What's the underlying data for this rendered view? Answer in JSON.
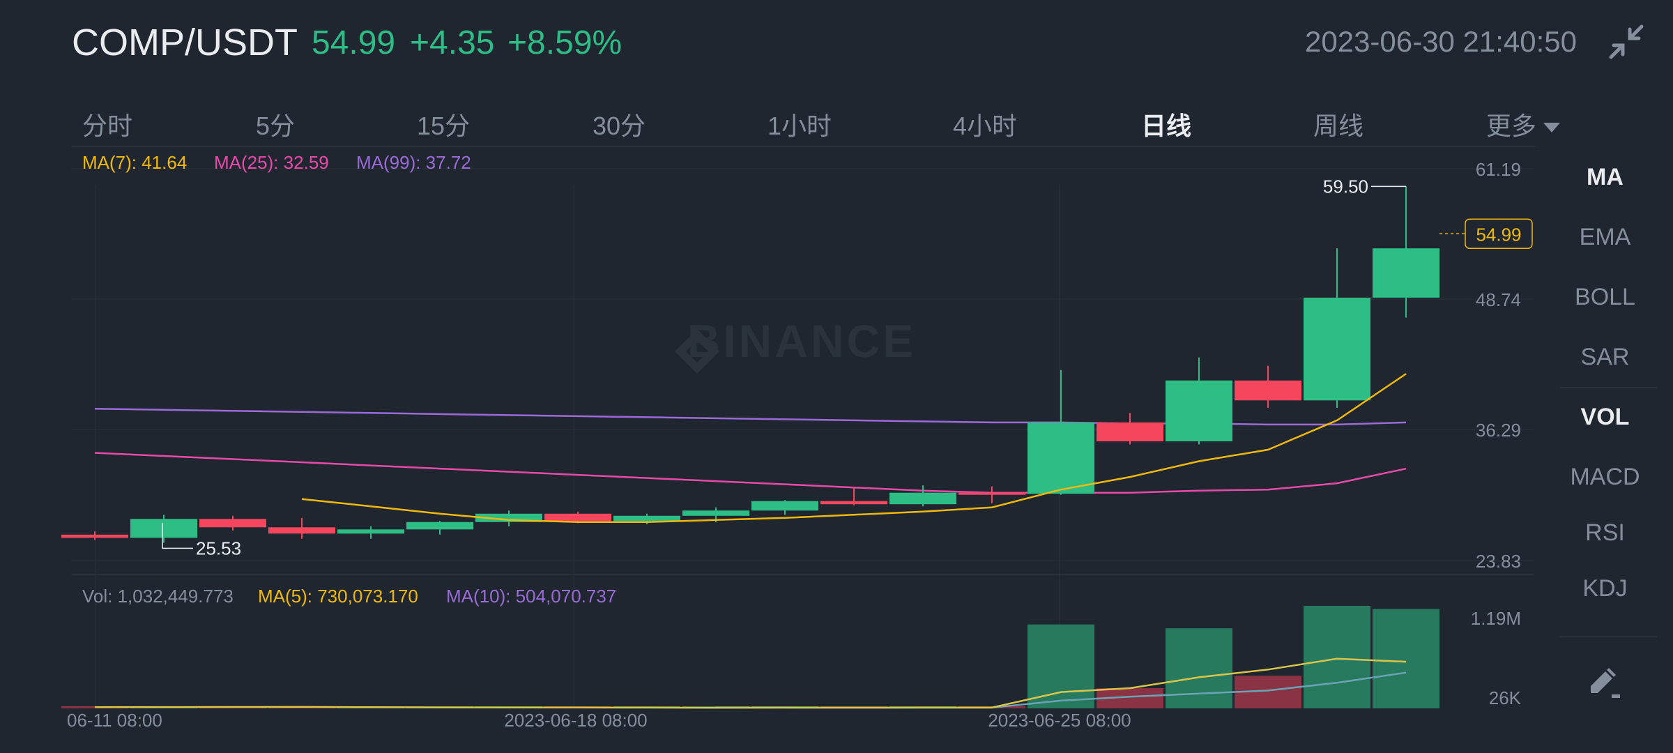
{
  "header": {
    "pair": "COMP/USDT",
    "price": "54.99",
    "change": "+4.35",
    "change_pct": "+8.59%",
    "datetime": "2023-06-30 21:40:50",
    "icon": "collapse-arrows-icon"
  },
  "tabs": [
    {
      "label": "分时",
      "active": false
    },
    {
      "label": "5分",
      "active": false
    },
    {
      "label": "15分",
      "active": false
    },
    {
      "label": "30分",
      "active": false
    },
    {
      "label": "1小时",
      "active": false
    },
    {
      "label": "4小时",
      "active": false
    },
    {
      "label": "日线",
      "active": true
    },
    {
      "label": "周线",
      "active": false
    },
    {
      "label": "更多",
      "active": false
    }
  ],
  "side_indicators": [
    {
      "label": "MA",
      "active": true
    },
    {
      "label": "EMA",
      "active": false
    },
    {
      "label": "BOLL",
      "active": false
    },
    {
      "label": "SAR",
      "active": false
    },
    {
      "label": "VOL",
      "active": true
    },
    {
      "label": "MACD",
      "active": false
    },
    {
      "label": "RSI",
      "active": false
    },
    {
      "label": "KDJ",
      "active": false
    }
  ],
  "colors": {
    "up": "#2ebd85",
    "down": "#f6465d",
    "ma7": "#f0b90b",
    "ma25": "#e84aa9",
    "ma99": "#9a6bd6",
    "vol_ma5": "#d9c54a",
    "vol_ma10": "#6aa3b5",
    "bg": "#1f2630",
    "grid": "#2b3139",
    "text": "#848e9c"
  },
  "legend": {
    "ma7": "MA(7): 41.64",
    "ma25": "MA(25): 32.59",
    "ma99": "MA(99): 37.72",
    "vol": "Vol: 1,032,449.773",
    "vol_ma5": "MA(5): 730,073.170",
    "vol_ma10": "MA(10): 504,070.737"
  },
  "watermark": "BINANCE",
  "chart_data": {
    "type": "candlestick",
    "y_ticks": [
      "61.19",
      "48.74",
      "36.29",
      "23.83"
    ],
    "ylim": [
      23.83,
      61.19
    ],
    "vol_ticks": [
      "1.19M",
      "26K"
    ],
    "x_ticks": [
      "06-11 08:00",
      "2023-06-18 08:00",
      "2023-06-25 08:00"
    ],
    "high_label": "59.50",
    "low_label": "25.53",
    "current_price_label": "54.99",
    "candles": [
      {
        "o": 26.3,
        "h": 26.6,
        "l": 25.8,
        "c": 26.0
      },
      {
        "o": 26.0,
        "h": 28.2,
        "l": 25.53,
        "c": 27.8
      },
      {
        "o": 27.8,
        "h": 28.1,
        "l": 26.7,
        "c": 27.0
      },
      {
        "o": 27.0,
        "h": 27.9,
        "l": 25.9,
        "c": 26.4
      },
      {
        "o": 26.4,
        "h": 27.1,
        "l": 25.9,
        "c": 26.8
      },
      {
        "o": 26.8,
        "h": 27.6,
        "l": 26.3,
        "c": 27.5
      },
      {
        "o": 27.5,
        "h": 28.6,
        "l": 27.1,
        "c": 28.3
      },
      {
        "o": 28.3,
        "h": 28.5,
        "l": 27.4,
        "c": 27.6
      },
      {
        "o": 27.6,
        "h": 28.3,
        "l": 27.3,
        "c": 28.1
      },
      {
        "o": 28.1,
        "h": 28.9,
        "l": 27.5,
        "c": 28.6
      },
      {
        "o": 28.6,
        "h": 29.6,
        "l": 28.2,
        "c": 29.5
      },
      {
        "o": 29.5,
        "h": 30.8,
        "l": 29.1,
        "c": 29.2
      },
      {
        "o": 29.2,
        "h": 31.0,
        "l": 29.0,
        "c": 30.3
      },
      {
        "o": 30.3,
        "h": 30.9,
        "l": 29.3,
        "c": 30.2
      },
      {
        "o": 30.2,
        "h": 42.0,
        "l": 30.1,
        "c": 37.0
      },
      {
        "o": 37.0,
        "h": 37.9,
        "l": 34.9,
        "c": 35.2
      },
      {
        "o": 35.2,
        "h": 43.2,
        "l": 34.9,
        "c": 41.0
      },
      {
        "o": 41.0,
        "h": 42.4,
        "l": 38.4,
        "c": 39.1
      },
      {
        "o": 39.1,
        "h": 53.6,
        "l": 38.4,
        "c": 48.9
      },
      {
        "o": 48.9,
        "h": 59.5,
        "l": 47.0,
        "c": 53.6
      }
    ],
    "ma7": [
      null,
      null,
      null,
      29.7,
      29.0,
      28.3,
      27.7,
      27.5,
      27.5,
      27.7,
      27.9,
      28.2,
      28.5,
      28.9,
      30.6,
      31.8,
      33.3,
      34.4,
      37.2,
      41.64
    ],
    "ma25": [
      34.1,
      33.8,
      33.5,
      33.2,
      32.9,
      32.6,
      32.3,
      32.0,
      31.7,
      31.4,
      31.1,
      30.8,
      30.5,
      30.3,
      30.3,
      30.3,
      30.5,
      30.6,
      31.2,
      32.59
    ],
    "ma99": [
      38.3,
      38.2,
      38.1,
      38.0,
      37.9,
      37.8,
      37.7,
      37.6,
      37.5,
      37.4,
      37.3,
      37.2,
      37.1,
      37.0,
      37.0,
      36.9,
      36.9,
      36.8,
      36.8,
      37.0
    ],
    "volumes": [
      15,
      22,
      19,
      25,
      9,
      8,
      7,
      10,
      8,
      9,
      12,
      9,
      11,
      10,
      1080,
      260,
      1030,
      420,
      1320,
      1280
    ],
    "vol_ma5": [
      16,
      17,
      18,
      19,
      15,
      13,
      12,
      11,
      10,
      8,
      9,
      9,
      10,
      10,
      210,
      260,
      400,
      500,
      640,
      600
    ],
    "vol_ma10": [
      null,
      null,
      null,
      null,
      null,
      null,
      null,
      null,
      null,
      12,
      11,
      10,
      10,
      10,
      100,
      150,
      190,
      230,
      330,
      460
    ]
  }
}
